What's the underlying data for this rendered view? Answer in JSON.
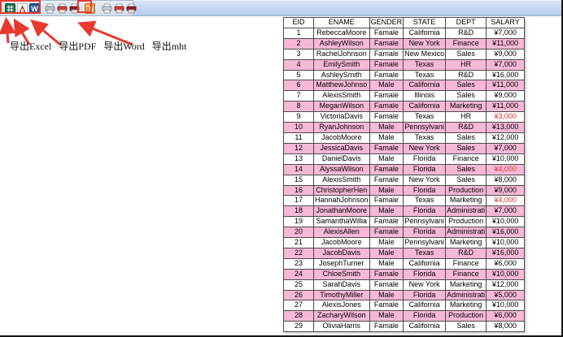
{
  "window": {
    "background": "#ffffff",
    "frame_color": "#151515"
  },
  "toolbar": {
    "background_left": "#dbe5f0",
    "background_right_top": "#d8e5fa",
    "background_right_bottom": "#b4caeb",
    "buttons": [
      {
        "icon": "excel-icon"
      },
      {
        "icon": "pdf-icon"
      },
      {
        "icon": "word-icon"
      },
      {
        "icon": "printer-icon"
      },
      {
        "icon": "printer-red-icon"
      },
      {
        "icon": "printer-darkred-icon"
      },
      {
        "icon": "mht-icon"
      },
      {
        "icon": "printer-icon"
      },
      {
        "icon": "printer-red-icon"
      },
      {
        "icon": "printer-darkred-icon"
      }
    ]
  },
  "annotation": {
    "color": "#e8392f",
    "labels": [
      "导出Excel",
      "导出PDF",
      "导出Word",
      "导出mht"
    ]
  },
  "table": {
    "columns": [
      "EID",
      "ENAME",
      "GENDER",
      "STATE",
      "DEPT",
      "SALARY"
    ],
    "highlight_color": "#f7b8d6",
    "alert_color": "#e53528",
    "rows": [
      {
        "eid": 1,
        "ename": "RebeccaMoore",
        "gender": "Famale",
        "state": "California",
        "dept": "R&D",
        "salary": "¥7,000",
        "highlighted": false,
        "salary_alert": false
      },
      {
        "eid": 2,
        "ename": "AshleyWilson",
        "gender": "Famale",
        "state": "New York",
        "dept": "Finance",
        "salary": "¥11,000",
        "highlighted": true,
        "salary_alert": false
      },
      {
        "eid": 3,
        "ename": "RachelJohnson",
        "gender": "Famale",
        "state": "New Mexico",
        "dept": "Sales",
        "salary": "¥9,000",
        "highlighted": false,
        "salary_alert": false
      },
      {
        "eid": 4,
        "ename": "EmilySmith",
        "gender": "Famale",
        "state": "Texas",
        "dept": "HR",
        "salary": "¥7,000",
        "highlighted": true,
        "salary_alert": false
      },
      {
        "eid": 5,
        "ename": "AshleySmith",
        "gender": "Famale",
        "state": "Texas",
        "dept": "R&D",
        "salary": "¥16,000",
        "highlighted": false,
        "salary_alert": false
      },
      {
        "eid": 6,
        "ename": "MatthewJohnso",
        "gender": "Male",
        "state": "California",
        "dept": "Sales",
        "salary": "¥11,000",
        "highlighted": true,
        "salary_alert": false
      },
      {
        "eid": 7,
        "ename": "AlexisSmith",
        "gender": "Famale",
        "state": "Illinois",
        "dept": "Sales",
        "salary": "¥9,000",
        "highlighted": false,
        "salary_alert": false
      },
      {
        "eid": 8,
        "ename": "MeganWilson",
        "gender": "Famale",
        "state": "California",
        "dept": "Marketing",
        "salary": "¥11,000",
        "highlighted": true,
        "salary_alert": false
      },
      {
        "eid": 9,
        "ename": "VictoriaDavis",
        "gender": "Famale",
        "state": "Texas",
        "dept": "HR",
        "salary": "¥3,000",
        "highlighted": false,
        "salary_alert": true
      },
      {
        "eid": 10,
        "ename": "RyanJohnson",
        "gender": "Male",
        "state": "Pennsylvani",
        "dept": "R&D",
        "salary": "¥13,000",
        "highlighted": true,
        "salary_alert": false
      },
      {
        "eid": 11,
        "ename": "JacobMoore",
        "gender": "Male",
        "state": "Texas",
        "dept": "Sales",
        "salary": "¥12,000",
        "highlighted": false,
        "salary_alert": false
      },
      {
        "eid": 12,
        "ename": "JessicaDavis",
        "gender": "Famale",
        "state": "New York",
        "dept": "Sales",
        "salary": "¥7,000",
        "highlighted": true,
        "salary_alert": false
      },
      {
        "eid": 13,
        "ename": "DanielDavis",
        "gender": "Male",
        "state": "Florida",
        "dept": "Finance",
        "salary": "¥10,000",
        "highlighted": false,
        "salary_alert": false
      },
      {
        "eid": 14,
        "ename": "AlyssaWilson",
        "gender": "Famale",
        "state": "Florida",
        "dept": "Sales",
        "salary": "¥4,000",
        "highlighted": true,
        "salary_alert": true
      },
      {
        "eid": 15,
        "ename": "AlexisSmith",
        "gender": "Famale",
        "state": "New York",
        "dept": "Sales",
        "salary": "¥8,000",
        "highlighted": false,
        "salary_alert": false
      },
      {
        "eid": 16,
        "ename": "ChristopherHen",
        "gender": "Male",
        "state": "Florida",
        "dept": "Production",
        "salary": "¥9,000",
        "highlighted": true,
        "salary_alert": false
      },
      {
        "eid": 17,
        "ename": "HannahJohnson",
        "gender": "Famale",
        "state": "Texas",
        "dept": "Marketing",
        "salary": "¥4,000",
        "highlighted": false,
        "salary_alert": true
      },
      {
        "eid": 18,
        "ename": "JonathanMoore",
        "gender": "Male",
        "state": "Florida",
        "dept": "Administrati",
        "salary": "¥7,000",
        "highlighted": true,
        "salary_alert": false
      },
      {
        "eid": 19,
        "ename": "SamanthaWillia",
        "gender": "Famale",
        "state": "Pennsylvani",
        "dept": "Production",
        "salary": "¥10,000",
        "highlighted": false,
        "salary_alert": false
      },
      {
        "eid": 20,
        "ename": "AlexisAllen",
        "gender": "Famale",
        "state": "Florida",
        "dept": "Administrati",
        "salary": "¥16,000",
        "highlighted": true,
        "salary_alert": false
      },
      {
        "eid": 21,
        "ename": "JacobMoore",
        "gender": "Male",
        "state": "Pennsylvani",
        "dept": "Marketing",
        "salary": "¥10,000",
        "highlighted": false,
        "salary_alert": false
      },
      {
        "eid": 22,
        "ename": "JacobDavis",
        "gender": "Male",
        "state": "Texas",
        "dept": "R&D",
        "salary": "¥16,000",
        "highlighted": true,
        "salary_alert": false
      },
      {
        "eid": 23,
        "ename": "JosephTurner",
        "gender": "Male",
        "state": "California",
        "dept": "Finance",
        "salary": "¥6,000",
        "highlighted": false,
        "salary_alert": false
      },
      {
        "eid": 24,
        "ename": "ChloeSmith",
        "gender": "Famale",
        "state": "Florida",
        "dept": "Finance",
        "salary": "¥10,000",
        "highlighted": true,
        "salary_alert": false
      },
      {
        "eid": 25,
        "ename": "SarahDavis",
        "gender": "Famale",
        "state": "New York",
        "dept": "Marketing",
        "salary": "¥12,000",
        "highlighted": false,
        "salary_alert": false
      },
      {
        "eid": 26,
        "ename": "TimothyMiller",
        "gender": "Male",
        "state": "Florida",
        "dept": "Administrati",
        "salary": "¥5,000",
        "highlighted": true,
        "salary_alert": false
      },
      {
        "eid": 27,
        "ename": "AlexisJones",
        "gender": "Famale",
        "state": "California",
        "dept": "Marketing",
        "salary": "¥10,000",
        "highlighted": false,
        "salary_alert": false
      },
      {
        "eid": 28,
        "ename": "ZacharyWilson",
        "gender": "Male",
        "state": "Florida",
        "dept": "Production",
        "salary": "¥6,000",
        "highlighted": true,
        "salary_alert": false
      },
      {
        "eid": 29,
        "ename": "OliviaHarris",
        "gender": "Famale",
        "state": "California",
        "dept": "Sales",
        "salary": "¥8,000",
        "highlighted": false,
        "salary_alert": false
      }
    ]
  }
}
